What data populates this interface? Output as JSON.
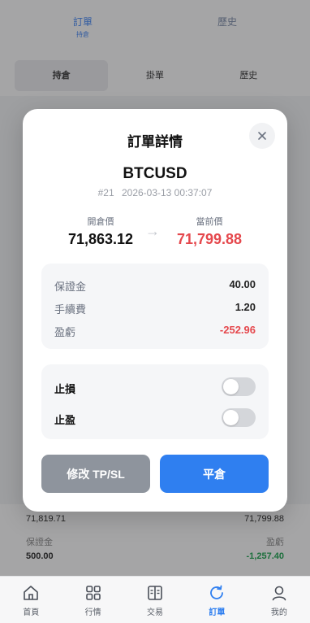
{
  "background": {
    "tabs": [
      {
        "label": "訂單",
        "sub": "持倉"
      },
      {
        "label": "歷史"
      }
    ],
    "segments": [
      "持倉",
      "掛單",
      "歷史"
    ],
    "row1": {
      "left": "71,819.71",
      "right": "71,799.88"
    },
    "row2": {
      "left": "保證金",
      "right": "盈虧",
      "left_val": "500.00",
      "right_val": "-1,257.40"
    }
  },
  "modal": {
    "title": "訂單詳情",
    "close_icon": "close-icon",
    "symbol": "BTCUSD",
    "order_id": "#21",
    "datetime": "2026-03-13 00:37:07",
    "open_label": "開倉價",
    "open_price": "71,863.12",
    "current_label": "當前價",
    "current_price": "71,799.88",
    "arrow": "→",
    "info": {
      "margin_label": "保證金",
      "margin_value": "40.00",
      "fee_label": "手續費",
      "fee_value": "1.20",
      "pnl_label": "盈虧",
      "pnl_value": "-252.96"
    },
    "stop_loss_label": "止損",
    "stop_loss_on": false,
    "take_profit_label": "止盈",
    "take_profit_on": false,
    "modify_button": "修改 TP/SL",
    "close_button": "平倉"
  },
  "colors": {
    "accent": "#2f7ff0",
    "negative": "#e5484d",
    "disabled_button": "#8e949d"
  },
  "tabbar": [
    {
      "label": "首頁",
      "icon": "home-icon"
    },
    {
      "label": "行情",
      "icon": "grid-icon"
    },
    {
      "label": "交易",
      "icon": "book-icon"
    },
    {
      "label": "訂單",
      "icon": "refresh-icon",
      "active": true
    },
    {
      "label": "我的",
      "icon": "user-icon"
    }
  ]
}
